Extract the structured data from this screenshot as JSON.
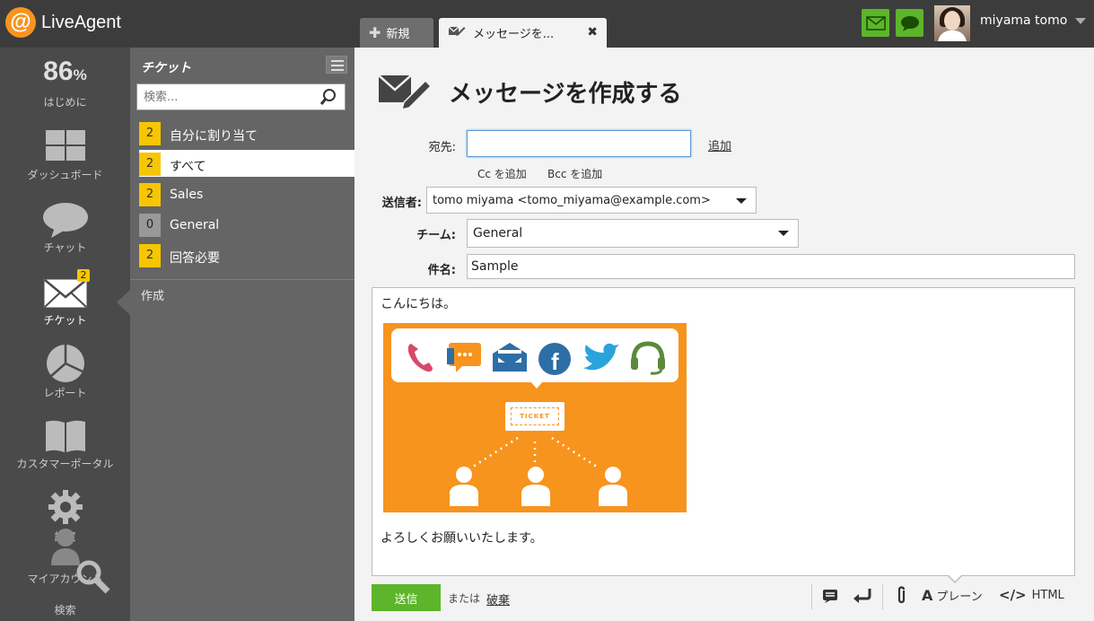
{
  "app": {
    "name": "LiveAgent",
    "logo_mark": "@"
  },
  "tabs": [
    {
      "label": "新規",
      "icon": "plus-icon"
    },
    {
      "label": "メッセージを...",
      "icon": "compose-icon"
    }
  ],
  "header": {
    "user_name": "miyama tomo",
    "accent": "#5cb52a"
  },
  "nav": {
    "start_percent": "86",
    "start_percent_sign": "%",
    "start_label": "はじめに",
    "dashboard_label": "ダッシュボード",
    "chat_label": "チャット",
    "ticket_label": "チケット",
    "ticket_badge": "2",
    "report_label": "レポート",
    "portal_label": "カスタマーポータル",
    "settings_label": "設定",
    "account_label": "マイアカウント",
    "search_label": "検索"
  },
  "ticket_panel": {
    "title": "チケット",
    "search_placeholder": "検索...",
    "items": [
      {
        "count": "2",
        "label": "自分に割り当て"
      },
      {
        "count": "2",
        "label": "すべて"
      },
      {
        "count": "2",
        "label": "Sales"
      },
      {
        "count": "0",
        "label": "General"
      },
      {
        "count": "2",
        "label": "回答必要"
      }
    ],
    "create_label": "作成"
  },
  "compose": {
    "title": "メッセージを作成する",
    "to_label": "宛先:",
    "to_value": "",
    "add_label": "追加",
    "cc_label": "Cc を追加",
    "bcc_label": "Bcc を追加",
    "from_label": "送信者:",
    "from_value": "tomo miyama <tomo_miyama@example.com>",
    "team_label": "チーム:",
    "team_value": "General",
    "subject_label": "件名:",
    "subject_value": "Sample",
    "body_greeting": "こんにちは。",
    "body_closing": "よろしくお願いいたします。",
    "illustration_ticket_text": "TICKET",
    "send_label": "送信",
    "or_label": "または",
    "discard_label": "破棄",
    "plain_label": "プレーン",
    "html_label": "HTML"
  }
}
